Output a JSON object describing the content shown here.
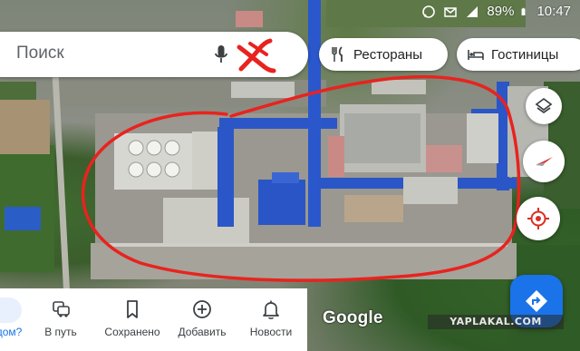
{
  "status_bar": {
    "battery": "89%",
    "time": "10:47",
    "icons": [
      "whatsapp-icon",
      "mail-icon",
      "signal-icon",
      "battery-icon"
    ]
  },
  "search": {
    "placeholder": "Поиск",
    "mic_icon": "mic-icon",
    "avatar_icon": "avatar-crossed-icon"
  },
  "chips": [
    {
      "label": "Рестораны",
      "icon": "fork-knife-icon"
    },
    {
      "label": "Гостиницы",
      "icon": "bed-icon"
    }
  ],
  "map_controls": {
    "layers_icon": "layers-icon",
    "compass_icon": "compass-icon",
    "location_icon": "my-location-icon",
    "directions_icon": "directions-icon"
  },
  "google_logo": "Google",
  "watermark": "YAPLAKAL.COM",
  "bottom_nav": {
    "items": [
      {
        "label": "дом?",
        "icon": "explore-icon"
      },
      {
        "label": "В путь",
        "icon": "car-icon"
      },
      {
        "label": "Сохранено",
        "icon": "bookmark-icon"
      },
      {
        "label": "Добавить",
        "icon": "add-circle-icon"
      },
      {
        "label": "Новости",
        "icon": "bell-icon"
      }
    ]
  },
  "colors": {
    "accent_blue": "#1a73e8",
    "annotation_red": "#e8231f",
    "building_blue": "#2a57c9",
    "compass_red": "#d93025"
  }
}
